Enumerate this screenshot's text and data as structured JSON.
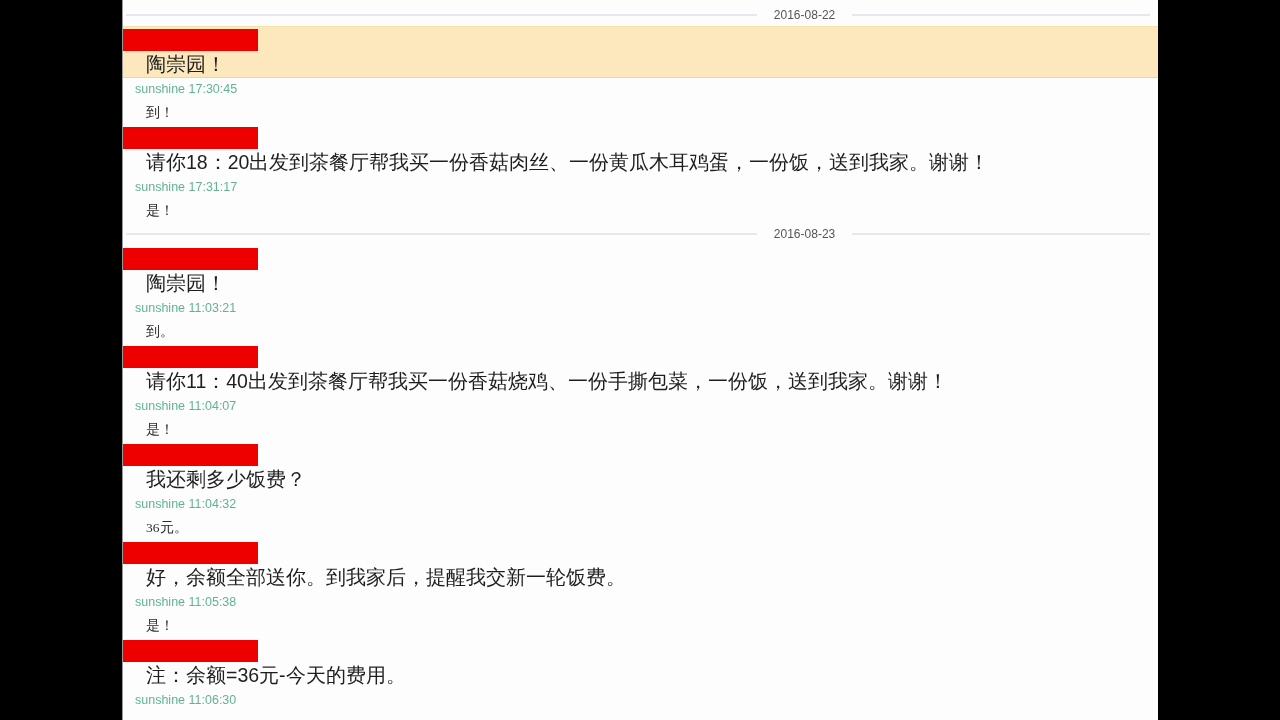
{
  "days": [
    {
      "date": "2016-08-22",
      "messages": [
        {
          "sender_redacted": true,
          "highlighted": true,
          "text": "陶崇园！",
          "reply": {
            "sender": "sunshine",
            "time": "17:30:45",
            "text": "到！"
          }
        },
        {
          "sender_redacted": true,
          "highlighted": false,
          "text": "请你18：20出发到茶餐厅帮我买一份香菇肉丝、一份黄瓜木耳鸡蛋，一份饭，送到我家。谢谢！",
          "reply": {
            "sender": "sunshine",
            "time": "17:31:17",
            "text": "是！"
          }
        }
      ]
    },
    {
      "date": "2016-08-23",
      "messages": [
        {
          "sender_redacted": true,
          "highlighted": false,
          "text": "陶崇园！",
          "reply": {
            "sender": "sunshine",
            "time": "11:03:21",
            "text": "到。"
          }
        },
        {
          "sender_redacted": true,
          "highlighted": false,
          "text": "请你11：40出发到茶餐厅帮我买一份香菇烧鸡、一份手撕包菜，一份饭，送到我家。谢谢！",
          "reply": {
            "sender": "sunshine",
            "time": "11:04:07",
            "text": "是！"
          }
        },
        {
          "sender_redacted": true,
          "highlighted": false,
          "text": "我还剩多少饭费？",
          "reply": {
            "sender": "sunshine",
            "time": "11:04:32",
            "text": "36元。"
          }
        },
        {
          "sender_redacted": true,
          "highlighted": false,
          "text": "好，余额全部送你。到我家后，提醒我交新一轮饭费。",
          "reply": {
            "sender": "sunshine",
            "time": "11:05:38",
            "text": "是！"
          }
        },
        {
          "sender_redacted": true,
          "highlighted": false,
          "text": "注：余额=36元-今天的费用。",
          "reply": {
            "sender": "sunshine",
            "time": "11:06:30"
          }
        }
      ]
    }
  ]
}
